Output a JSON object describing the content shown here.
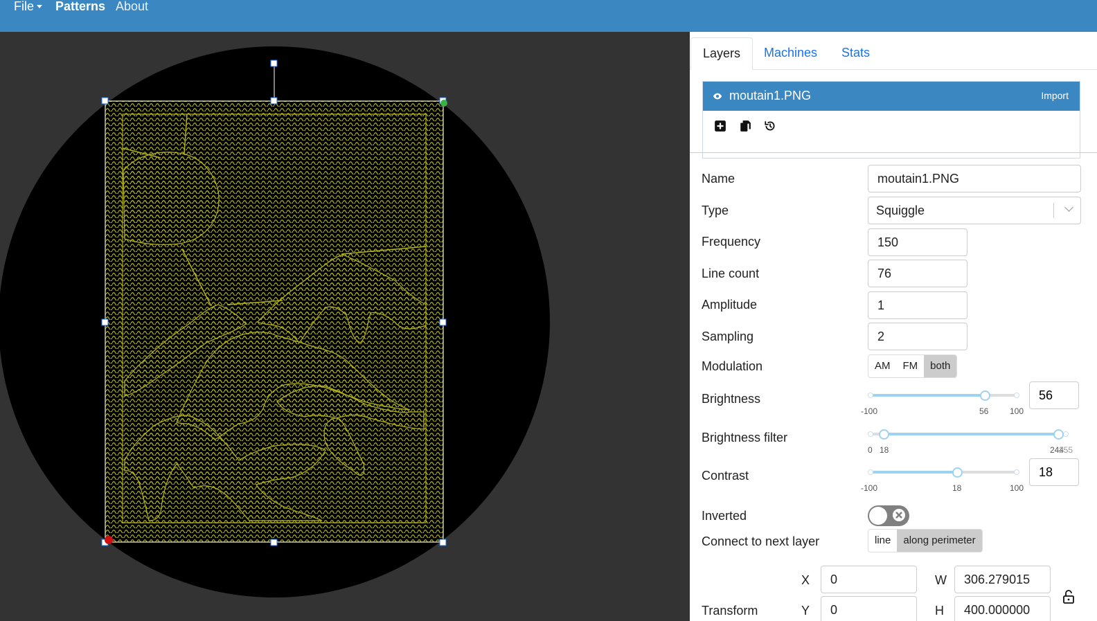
{
  "nav": {
    "file": "File",
    "patterns": "Patterns",
    "about": "About"
  },
  "tabs": {
    "layers": "Layers",
    "machines": "Machines",
    "stats": "Stats"
  },
  "layer": {
    "name": "moutain1.PNG",
    "import": "Import"
  },
  "icons": {
    "visibility": "eye-icon",
    "add": "plus-square-icon",
    "copy": "copy-icon",
    "reset": "history-icon",
    "lock": "unlock-icon"
  },
  "form": {
    "name_label": "Name",
    "name_value": "moutain1.PNG",
    "type_label": "Type",
    "type_value": "Squiggle",
    "frequency_label": "Frequency",
    "frequency_value": "150",
    "linecount_label": "Line count",
    "linecount_value": "76",
    "amplitude_label": "Amplitude",
    "amplitude_value": "1",
    "sampling_label": "Sampling",
    "sampling_value": "2",
    "modulation_label": "Modulation",
    "modulation_options": [
      "AM",
      "FM",
      "both"
    ],
    "modulation_selected": "both",
    "brightness_label": "Brightness",
    "brightness_value": "56",
    "brightness_min": "-100",
    "brightness_max": "100",
    "brightness_filter_label": "Brightness filter",
    "brightness_filter_min": "0",
    "brightness_filter_low": "18",
    "brightness_filter_high": "244",
    "brightness_filter_max": "255",
    "contrast_label": "Contrast",
    "contrast_value": "18",
    "contrast_min": "-100",
    "contrast_max": "100",
    "inverted_label": "Inverted",
    "inverted_on": false,
    "connect_label": "Connect to next layer",
    "connect_options": [
      "line",
      "along perimeter"
    ],
    "connect_selected": "along perimeter",
    "transform_label": "Transform",
    "x_label": "X",
    "x_value": "0",
    "y_label": "Y",
    "y_value": "0",
    "w_label": "W",
    "w_value": "306.279015",
    "h_label": "H",
    "h_value": "400.000000"
  },
  "colors": {
    "accent": "#3a87c1",
    "stroke": "#b3b31a",
    "canvas": "#333333",
    "slider": "#9ed3f0"
  }
}
